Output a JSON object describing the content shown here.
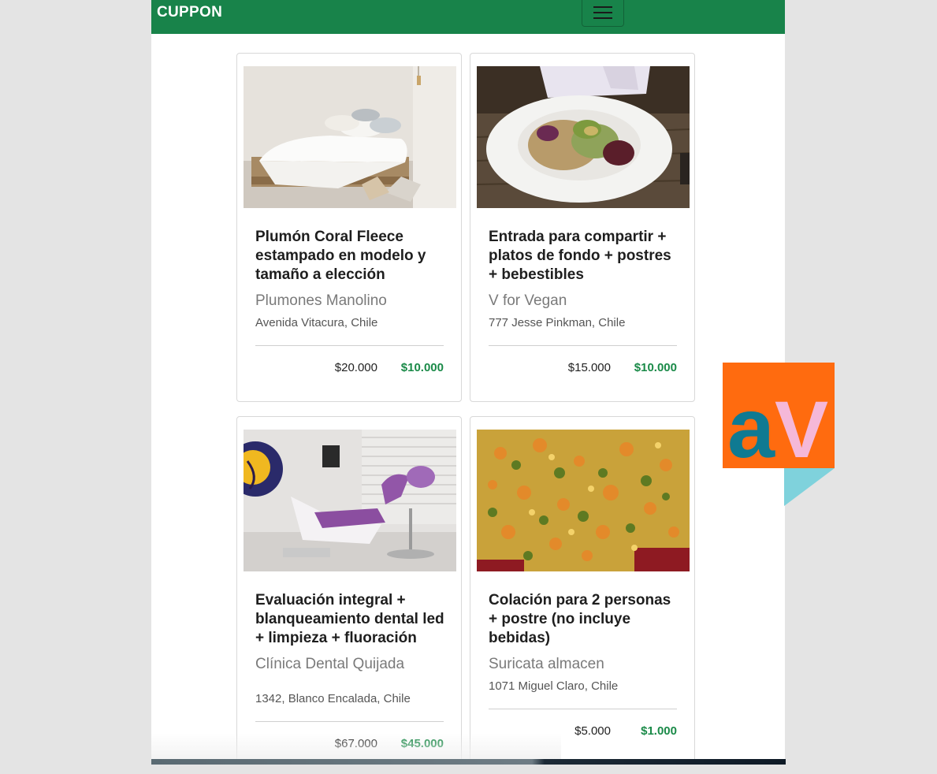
{
  "navbar": {
    "brand": "CUPPON",
    "menu_icon": "hamburger-icon",
    "color": "#18834a"
  },
  "deals": [
    {
      "title": "Plumón Coral Fleece estampado en modelo y tamaño a elección",
      "merchant": "Plumones Manolino",
      "address": "Avenida Vitacura, Chile",
      "old_price": "$20.000",
      "new_price": "$10.000"
    },
    {
      "title": "Entrada para compartir + platos de fondo + postres + bebestibles",
      "merchant": "V for Vegan",
      "address": "777 Jesse Pinkman, Chile",
      "old_price": "$15.000",
      "new_price": "$10.000"
    },
    {
      "title": "Evaluación integral + blanqueamiento dental led + limpieza + fluoración",
      "merchant": "Clínica Dental Quijada",
      "address": "1342, Blanco Encalada, Chile",
      "old_price": "$67.000",
      "new_price": "$45.000"
    },
    {
      "title": "Colación para 2 personas + postre (no incluye bebidas)",
      "merchant": "Suricata almacen",
      "address": "1071 Miguel Claro, Chile",
      "old_price": "$5.000",
      "new_price": "$1.000"
    }
  ],
  "colors": {
    "price_accent": "#1a8a48",
    "logo_orange": "#ff6b0f",
    "logo_teal": "#0f7a92",
    "logo_pink": "#f5b8d8",
    "logo_cyan": "#7fd2dc"
  },
  "logo": {
    "text": "aV"
  }
}
